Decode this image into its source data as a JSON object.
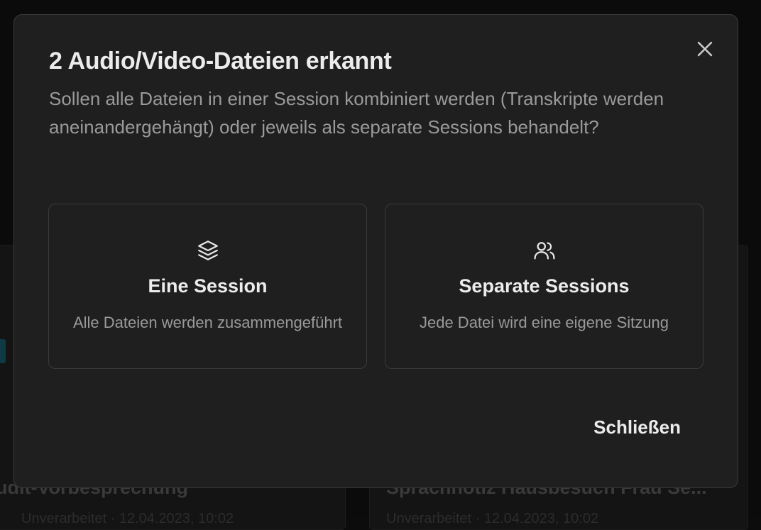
{
  "background": {
    "left_card_title": "udit-Vorbesprechung",
    "right_card_title": "Sprachnotiz Hausbesuch Frau Se...",
    "left_card_meta": "Unverarbeitet · 12.04.2023, 10:02",
    "right_card_meta": "Unverarbeitet · 12.04.2023, 10:02"
  },
  "dialog": {
    "title": "2 Audio/Video-Dateien erkannt",
    "description": "Sollen alle Dateien in einer Session kombiniert werden (Transkripte werden aneinandergehängt) oder jeweils als separate Sessions behandelt?",
    "close_icon": "close-icon",
    "options": [
      {
        "icon": "layers-icon",
        "title": "Eine Session",
        "description": "Alle Dateien werden zusammengeführt"
      },
      {
        "icon": "users-icon",
        "title": "Separate Sessions",
        "description": "Jede Datei wird eine eigene Sitzung"
      }
    ],
    "close_label": "Schließen"
  },
  "colors": {
    "dialog_bg": "#1f1f1f",
    "border": "#3b3b3b",
    "text_primary": "#ececec",
    "text_secondary": "#9a9a9a"
  }
}
